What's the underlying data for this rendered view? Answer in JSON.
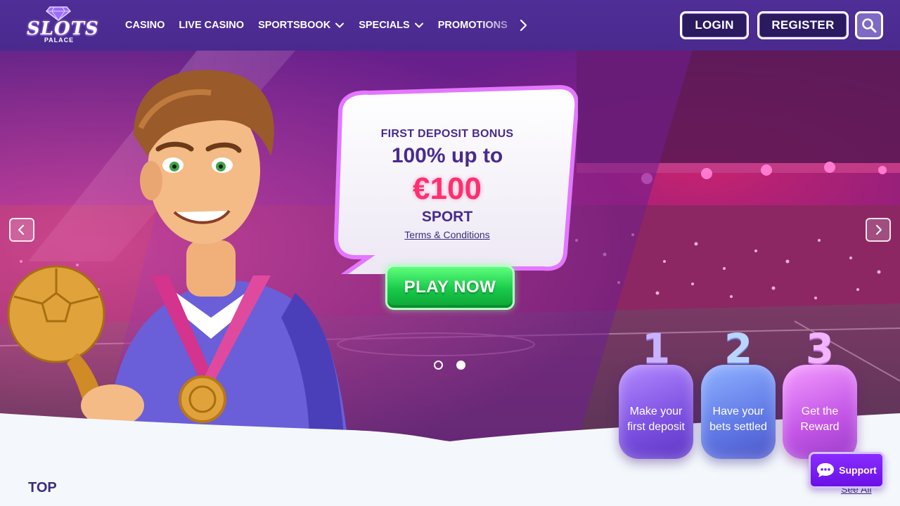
{
  "brand": {
    "logo_word": "SLOTS",
    "logo_sub": "PALACE"
  },
  "nav": {
    "items": [
      {
        "label": "CASINO",
        "has_dropdown": false
      },
      {
        "label": "LIVE CASINO",
        "has_dropdown": false
      },
      {
        "label": "SPORTSBOOK",
        "has_dropdown": true
      },
      {
        "label": "SPECIALS",
        "has_dropdown": true
      },
      {
        "label": "PROMOTIONS",
        "has_dropdown": false
      }
    ],
    "next_icon": "chevron-right-icon"
  },
  "header_actions": {
    "login_label": "LOGIN",
    "register_label": "REGISTER",
    "search_icon": "search-icon"
  },
  "hero": {
    "bonus_label": "FIRST DEPOSIT BONUS",
    "bonus_line": "100% up to",
    "bonus_amount": "€100",
    "bonus_product": "SPORT",
    "terms_link": "Terms & Conditions",
    "cta_label": "PLAY NOW",
    "carousel": {
      "total_slides": 2,
      "active_slide": 2
    },
    "steps": [
      {
        "number": "1",
        "text": "Make your first deposit"
      },
      {
        "number": "2",
        "text": "Have your bets settled"
      },
      {
        "number": "3",
        "text": "Get the Reward"
      }
    ]
  },
  "sections": {
    "top_title": "TOP",
    "see_all_label": "See All"
  },
  "support": {
    "label": "Support",
    "icon": "chat-icon"
  },
  "colors": {
    "header_bg": "#4f2e97",
    "accent_pink": "#ff2f6f",
    "cta_green": "#19c94a",
    "text_purple": "#4a2a8e"
  }
}
